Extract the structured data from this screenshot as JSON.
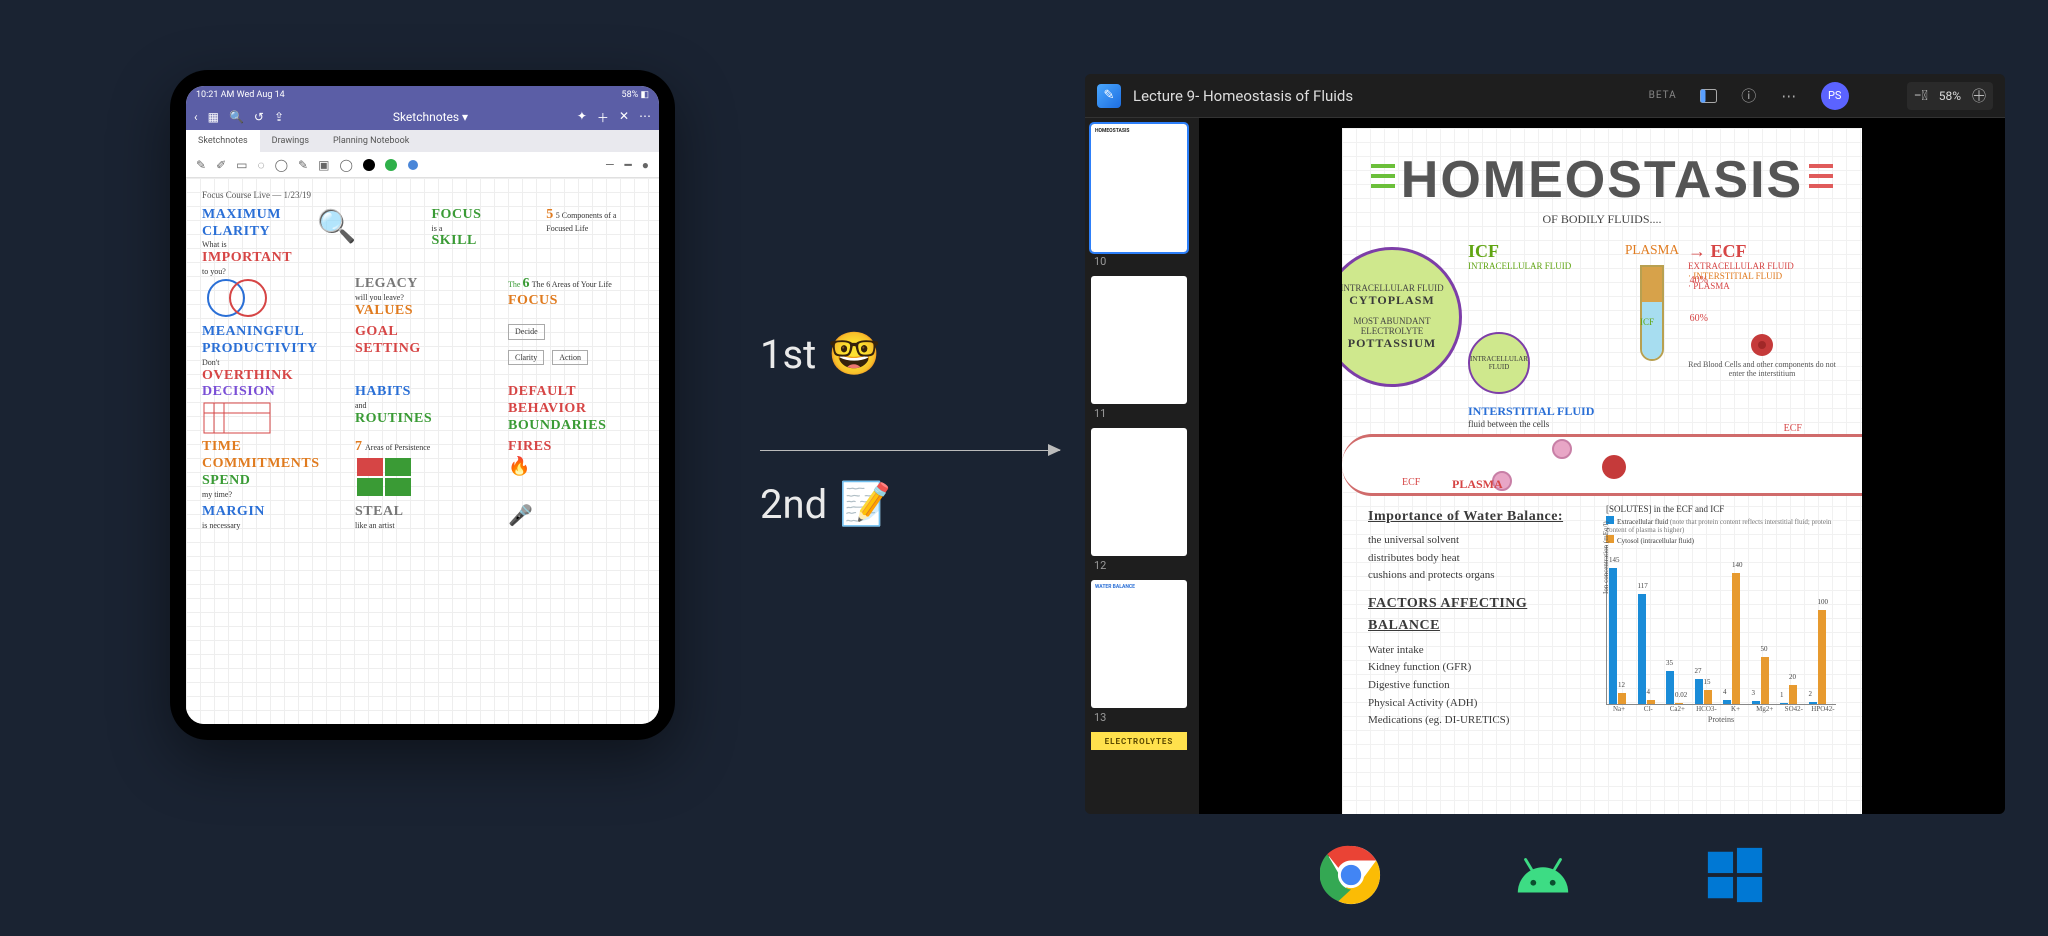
{
  "ipad": {
    "status_left": "10:21 AM  Wed Aug 14",
    "status_right": "58% ◧",
    "toolbar": {
      "back_icon": "‹",
      "grid_icon": "▦",
      "search_icon": "🔍",
      "undo_icon": "↺",
      "share_icon": "⇪",
      "tool_add_icon": "✦",
      "tool_plus_icon": "＋",
      "tool_close_icon": "✕",
      "tool_more_icon": "⋯"
    },
    "title": "Sketchnotes ▾",
    "tabs": [
      "Sketchnotes",
      "Drawings",
      "Planning Notebook"
    ],
    "paper": {
      "heading_date": "Focus Course Live — 1/23/19",
      "w1": "MAXIMUM",
      "w2": "CLARITY",
      "w3": "What is",
      "w4": "IMPORTANT",
      "w5": "to you?",
      "w6": "FOCUS",
      "w7": "is a",
      "w8": "SKILL",
      "w9": "LEGACY",
      "w10": "will you leave?",
      "w11": "VALUES",
      "w12": "MEANINGFUL",
      "w13": "PRODUCTIVITY",
      "w14": "GOAL",
      "w15": "SETTING",
      "w16": "Don't",
      "w17": "OVERTHINK",
      "w18": "DECISION",
      "w19": "HABITS",
      "w20": "and",
      "w21": "ROUTINES",
      "w22": "DEFAULT",
      "w23": "BEHAVIOR",
      "w24": "BOUNDARIES",
      "w25": "TIME",
      "w26": "COMMITMENTS",
      "w27": "SPEND",
      "w28": "my time?",
      "w29": "FIRES",
      "w30": "MARGIN",
      "w31": "is necessary",
      "w32": "STEAL",
      "w33": "like an artist",
      "w34": "Areas of Persistence",
      "w35": "The 6 Areas of Your Life",
      "w36": "5 Components of a Focused Life",
      "w37": "Decide",
      "w38": "Clarity",
      "w39": "Action"
    }
  },
  "center": {
    "first_label": "1st",
    "first_emoji": "🤓",
    "second_label": "2nd",
    "second_emoji": "📝"
  },
  "app": {
    "title": "Lecture 9- Homeostasis of Fluids",
    "beta": "BETA",
    "avatar": "PS",
    "zoom": "58%",
    "thumbs": [
      {
        "num": "",
        "kind": "notes",
        "label": "HOMEOSTASIS"
      },
      {
        "num": "10",
        "kind": "text"
      },
      {
        "num": "11",
        "kind": "text"
      },
      {
        "num": "12",
        "kind": "text"
      },
      {
        "num": "13",
        "kind": "notes",
        "label": "WATER BALANCE"
      },
      {
        "num": "",
        "kind": "banner",
        "label": "ELECTROLYTES"
      }
    ],
    "page": {
      "title": "HOMEOSTASIS",
      "subtitle": "OF BODILY FLUIDS....",
      "icf_label": "ICF",
      "icf_sub": "INTRACELLULAR FLUID",
      "ecf_label": "ECF",
      "ecf_sub": "EXTRACELLULAR FLUID",
      "ecf_parts1": "· INTERSTITIAL FLUID",
      "ecf_parts2": "· PLASMA",
      "plasma_lbl": "PLASMA",
      "tube_top_pct": "40%",
      "tube_bot_pct": "60%",
      "tube_bot_lbl": "ICF",
      "interstitial_lbl": "INTERSTITIAL FLUID",
      "cell_big_line1": "INTRACELLULAR FLUID",
      "cell_big_word": "CYTOPLASM",
      "cell_big_line2": "MOST ABUNDANT ELECTROLYTE",
      "cell_big_word2": "POTTASSIUM",
      "cell_small_lbl": "INTRACELLULAR FLUID",
      "interstitial_note": "fluid between the cells",
      "vessel_ecf": "ECF",
      "vessel_plasma": "PLASMA",
      "rbc_note": "Red Blood Cells and other components do not enter the interstitium",
      "solutes_header": "[SOLUTES] in the ECF and ICF",
      "importance_h": "Importance of Water Balance:",
      "importance1": "the universal solvent",
      "importance2": "distributes body heat",
      "importance3": "cushions and protects organs",
      "factors_h": "FACTORS AFFECTING BALANCE",
      "fact1": "Water intake",
      "fact2": "Kidney function (GFR)",
      "fact3": "Digestive function",
      "fact4": "Physical Activity (ADH)",
      "fact5": "Medications (eg. DI-URETICS)"
    }
  },
  "chart_data": {
    "type": "bar",
    "title": "[SOLUTES] in the ECF and ICF",
    "ylabel": "Ion concentration (mEq/l)",
    "xlabel": "Proteins",
    "ylim": [
      0,
      160
    ],
    "yticks": [
      0,
      20,
      40,
      60,
      80,
      100,
      120,
      140,
      160
    ],
    "categories": [
      "Na+",
      "Cl-",
      "Ca2+",
      "HCO3-",
      "K+",
      "Mg2+",
      "SO42-",
      "HPO42-"
    ],
    "series": [
      {
        "name": "Extracellular fluid",
        "color": "#1a8cd8",
        "note": "note that protein content reflects interstitial fluid; protein content of plasma is higher",
        "values": [
          145,
          117,
          35,
          27,
          4,
          3,
          1,
          2
        ]
      },
      {
        "name": "Cytosol (intracellular fluid)",
        "color": "#e79a2f",
        "values": [
          12,
          4,
          0.02,
          15,
          140,
          50,
          20,
          100
        ]
      }
    ]
  },
  "platform_icons": [
    "chrome",
    "android",
    "windows"
  ]
}
